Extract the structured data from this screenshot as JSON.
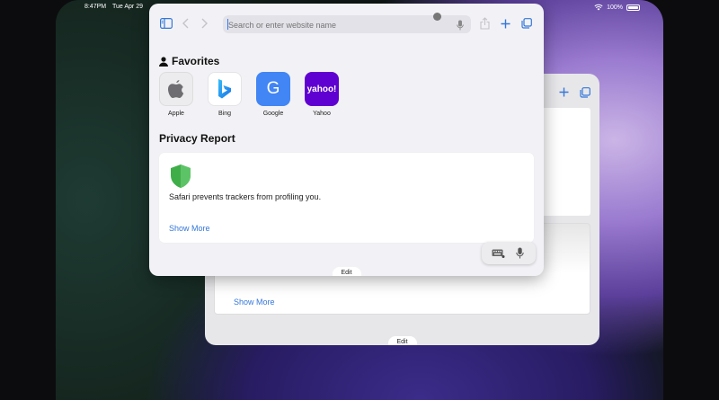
{
  "status": {
    "time": "8:47PM",
    "date": "Tue Apr 29",
    "battery": "100%"
  },
  "address_bar": {
    "placeholder": "Search or enter website name"
  },
  "favorites": {
    "title": "Favorites",
    "items": [
      {
        "label": "Apple",
        "icon": "apple-logo-icon"
      },
      {
        "label": "Bing",
        "icon": "bing-logo-icon"
      },
      {
        "label": "Google",
        "tile_text": "G",
        "color": "#4285f4"
      },
      {
        "label": "Yahoo",
        "tile_text": "yahoo!",
        "color": "#5f01d1"
      }
    ]
  },
  "privacy": {
    "title": "Privacy Report",
    "text": "Safari prevents trackers from profiling you.",
    "show_more": "Show More"
  },
  "background_window": {
    "show_more": "Show More",
    "edit": "Edit"
  },
  "front_window": {
    "edit": "Edit"
  },
  "colors": {
    "accent": "#3477d9",
    "shield": "#3fae49"
  }
}
